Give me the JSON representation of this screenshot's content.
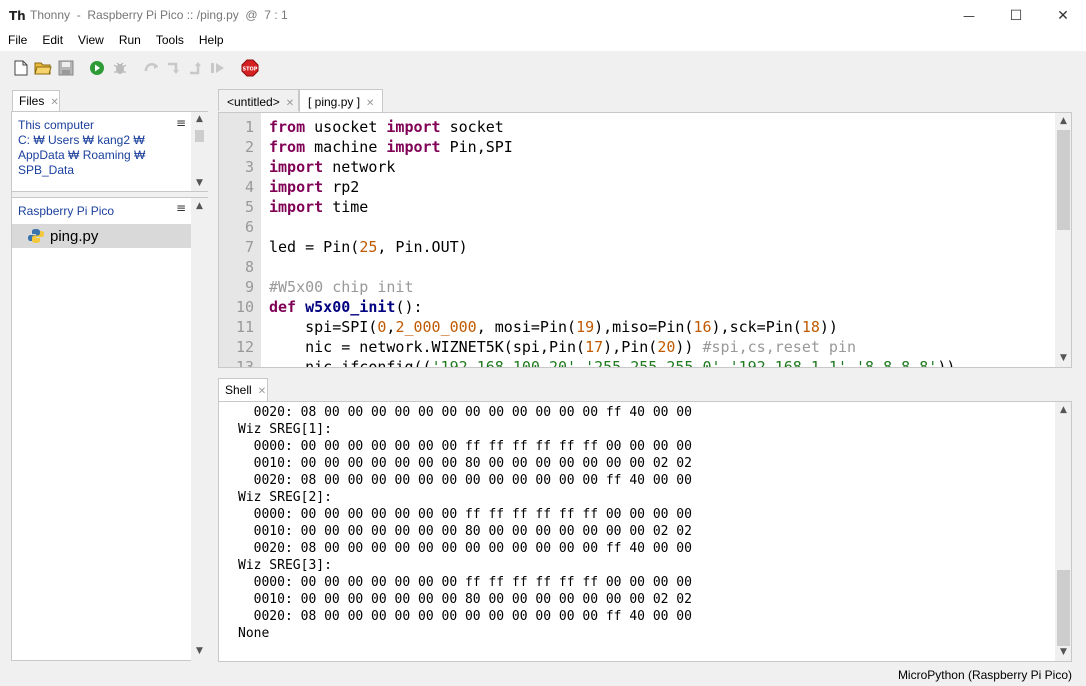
{
  "window": {
    "title": "Thonny  -  Raspberry Pi Pico :: /ping.py  @  7 : 1",
    "app_icon_text": "Th",
    "minimize": "—",
    "maximize": "☐",
    "close": "✕"
  },
  "menu": [
    "File",
    "Edit",
    "View",
    "Run",
    "Tools",
    "Help"
  ],
  "toolbar_icons": [
    "new-file-icon",
    "open-file-icon",
    "save-icon",
    "run-icon",
    "debug-icon",
    "step-over-icon",
    "step-into-icon",
    "step-out-icon",
    "resume-icon",
    "stop-icon"
  ],
  "files": {
    "tab_label": "Files",
    "computer_section": {
      "title": "This computer",
      "path_lines": [
        "C: ₩ Users ₩ kang2 ₩",
        "AppData ₩ Roaming ₩",
        "SPB_Data"
      ]
    },
    "device_section": {
      "title": "Raspberry Pi Pico",
      "files": [
        {
          "name": "ping.py"
        }
      ]
    }
  },
  "editor_tabs": [
    {
      "label": "<untitled>",
      "active": false
    },
    {
      "label": "[ ping.py ]",
      "active": true
    }
  ],
  "editor": {
    "line_numbers": [
      "1",
      "2",
      "3",
      "4",
      "5",
      "6",
      "7",
      "8",
      "9",
      "10",
      "11",
      "12",
      "13"
    ],
    "lines": [
      [
        {
          "t": "from",
          "c": "kw"
        },
        {
          "t": " usocket "
        },
        {
          "t": "import",
          "c": "kw"
        },
        {
          "t": " socket"
        }
      ],
      [
        {
          "t": "from",
          "c": "kw"
        },
        {
          "t": " machine "
        },
        {
          "t": "import",
          "c": "kw"
        },
        {
          "t": " Pin,SPI"
        }
      ],
      [
        {
          "t": "import",
          "c": "kw"
        },
        {
          "t": " network"
        }
      ],
      [
        {
          "t": "import",
          "c": "kw"
        },
        {
          "t": " rp2"
        }
      ],
      [
        {
          "t": "import",
          "c": "kw"
        },
        {
          "t": " time"
        }
      ],
      [],
      [
        {
          "t": "led = Pin("
        },
        {
          "t": "25",
          "c": "num"
        },
        {
          "t": ", Pin.OUT)"
        }
      ],
      [],
      [
        {
          "t": "#W5x00 chip init",
          "c": "cmt"
        }
      ],
      [
        {
          "t": "def",
          "c": "kw"
        },
        {
          "t": " "
        },
        {
          "t": "w5x00_init",
          "c": "fn"
        },
        {
          "t": "():"
        }
      ],
      [
        {
          "t": "    spi=SPI("
        },
        {
          "t": "0",
          "c": "num"
        },
        {
          "t": ","
        },
        {
          "t": "2_000_000",
          "c": "num"
        },
        {
          "t": ", mosi=Pin("
        },
        {
          "t": "19",
          "c": "num"
        },
        {
          "t": "),miso=Pin("
        },
        {
          "t": "16",
          "c": "num"
        },
        {
          "t": "),sck=Pin("
        },
        {
          "t": "18",
          "c": "num"
        },
        {
          "t": "))"
        }
      ],
      [
        {
          "t": "    nic = network.WIZNET5K(spi,Pin("
        },
        {
          "t": "17",
          "c": "num"
        },
        {
          "t": "),Pin("
        },
        {
          "t": "20",
          "c": "num"
        },
        {
          "t": ")) "
        },
        {
          "t": "#spi,cs,reset pin",
          "c": "cmt"
        }
      ],
      [
        {
          "t": "    nic.ifconfig(("
        },
        {
          "t": "'192.168.100.20'",
          "c": "str"
        },
        {
          "t": ","
        },
        {
          "t": "'255.255.255.0'",
          "c": "str"
        },
        {
          "t": ","
        },
        {
          "t": "'192.168.1.1'",
          "c": "str"
        },
        {
          "t": ","
        },
        {
          "t": "'8.8.8.8'",
          "c": "str"
        },
        {
          "t": "))"
        }
      ]
    ]
  },
  "shell": {
    "tab_label": "Shell",
    "lines": [
      "  0020: 08 00 00 00 00 00 00 00 00 00 00 00 00 ff 40 00 00",
      "Wiz SREG[1]:",
      "  0000: 00 00 00 00 00 00 00 ff ff ff ff ff ff 00 00 00 00",
      "  0010: 00 00 00 00 00 00 00 80 00 00 00 00 00 00 00 02 02",
      "  0020: 08 00 00 00 00 00 00 00 00 00 00 00 00 ff 40 00 00",
      "Wiz SREG[2]:",
      "  0000: 00 00 00 00 00 00 00 ff ff ff ff ff ff 00 00 00 00",
      "  0010: 00 00 00 00 00 00 00 80 00 00 00 00 00 00 00 02 02",
      "  0020: 08 00 00 00 00 00 00 00 00 00 00 00 00 ff 40 00 00",
      "Wiz SREG[3]:",
      "  0000: 00 00 00 00 00 00 00 ff ff ff ff ff ff 00 00 00 00",
      "  0010: 00 00 00 00 00 00 00 80 00 00 00 00 00 00 00 02 02",
      "  0020: 08 00 00 00 00 00 00 00 00 00 00 00 00 ff 40 00 00",
      "None"
    ]
  },
  "status": {
    "interpreter": "MicroPython (Raspberry Pi Pico)"
  },
  "colors": {
    "keyword": "#7f0055",
    "number": "#c05a00",
    "comment": "#999999",
    "string": "#1f7a1f",
    "link": "#1a3f9c"
  }
}
